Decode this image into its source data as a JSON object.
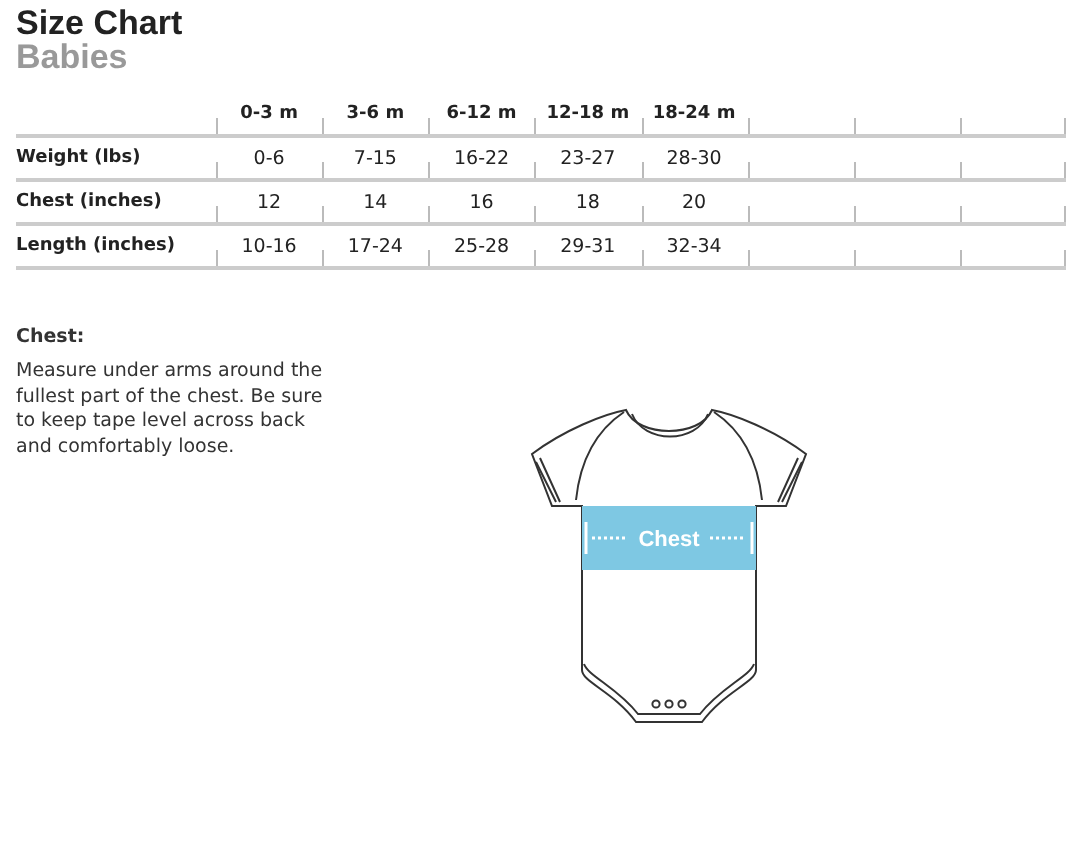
{
  "title": "Size Chart",
  "subtitle": "Babies",
  "table": {
    "columns": [
      "0-3 m",
      "3-6 m",
      "6-12 m",
      "12-18 m",
      "18-24 m"
    ],
    "rows": [
      {
        "label": "Weight (lbs)",
        "values": [
          "0-6",
          "7-15",
          "16-22",
          "23-27",
          "28-30"
        ]
      },
      {
        "label": "Chest (inches)",
        "values": [
          "12",
          "14",
          "16",
          "18",
          "20"
        ]
      },
      {
        "label": "Length (inches)",
        "values": [
          "10-16",
          "17-24",
          "25-28",
          "29-31",
          "32-34"
        ]
      }
    ]
  },
  "note": {
    "heading": "Chest:",
    "text": "Measure under arms around the fullest part of the chest. Be sure to keep tape level across back and comfortably loose."
  },
  "diagram": {
    "label": "Chest"
  }
}
